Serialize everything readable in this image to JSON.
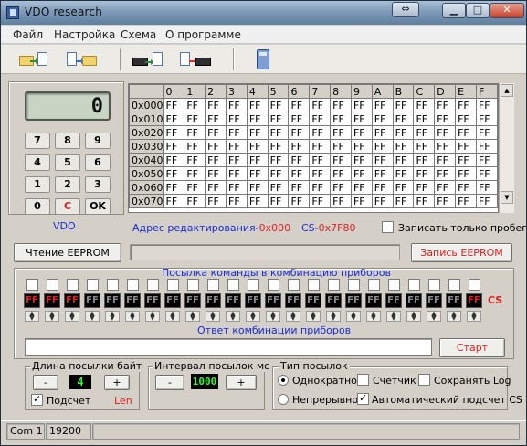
{
  "window": {
    "title": "VDO research",
    "arrows_glyph": "⇔"
  },
  "menu": [
    "Файл",
    "Настройка",
    "Схема",
    "О программе"
  ],
  "toolbar": [
    "open-to-file",
    "file-to-folder",
    "chip-to-file",
    "file-to-chip",
    "calculator"
  ],
  "calc": {
    "display": "0",
    "keys": [
      [
        "7",
        "8",
        "9"
      ],
      [
        "4",
        "5",
        "6"
      ],
      [
        "1",
        "2",
        "3"
      ],
      [
        "0",
        "C",
        "OK"
      ]
    ],
    "caption": "VDO",
    "red_key": "C"
  },
  "hex": {
    "columns": [
      "0",
      "1",
      "2",
      "3",
      "4",
      "5",
      "6",
      "7",
      "8",
      "9",
      "A",
      "B",
      "C",
      "D",
      "E",
      "F"
    ],
    "rows": [
      "0x000",
      "0x010",
      "0x020",
      "0x030",
      "0x040",
      "0x050",
      "0x060",
      "0x070"
    ],
    "fill": "FF",
    "address_label": "Адрес редактирования-",
    "address_value": "0x000",
    "cs_label": "CS-",
    "cs_value": "0x7F80",
    "write_only_gap": "Записать только пробег"
  },
  "eeprom": {
    "read": "Чтение EEPROM",
    "write": "Запись EEPROM"
  },
  "command": {
    "title": "Посылка команды в комбинацию приборов",
    "bytes": [
      "FF",
      "FF",
      "FF",
      "FF",
      "FF",
      "FF",
      "FF",
      "FF",
      "FF",
      "FF",
      "FF",
      "FF",
      "FF",
      "FF",
      "FF",
      "FF",
      "FF",
      "FF",
      "FF",
      "FF",
      "FF",
      "FF",
      "FF"
    ],
    "active": [
      true,
      true,
      true,
      false,
      false,
      false,
      false,
      false,
      false,
      false,
      false,
      false,
      false,
      false,
      false,
      false,
      false,
      false,
      false,
      false,
      false,
      false,
      true
    ],
    "cs": "CS",
    "response_title": "Ответ комбинации приборов",
    "response_value": "",
    "start": "Старт"
  },
  "length": {
    "title": "Длина посылки байт",
    "value": "4",
    "minus": "-",
    "plus": "+",
    "count_label": "Подсчет",
    "len": "Len",
    "count_checked": true
  },
  "interval": {
    "title": "Интервал посылок мс",
    "value": "1000",
    "minus": "-",
    "plus": "+"
  },
  "send_type": {
    "title": "Тип посылок",
    "once": "Однократно",
    "continuous": "Непрерывно",
    "counter": "Счетчик",
    "save_log": "Сохранять Log",
    "auto_cs": "Автоматический подсчет CS",
    "once_selected": true,
    "auto_cs_checked": true
  },
  "status": {
    "port": "Com 1",
    "baud": "19200"
  },
  "colors": {
    "red": "#e02020",
    "blue": "#1a2cd6",
    "green_led": "#3cf23c",
    "gray_led": "#8c8c8c"
  }
}
